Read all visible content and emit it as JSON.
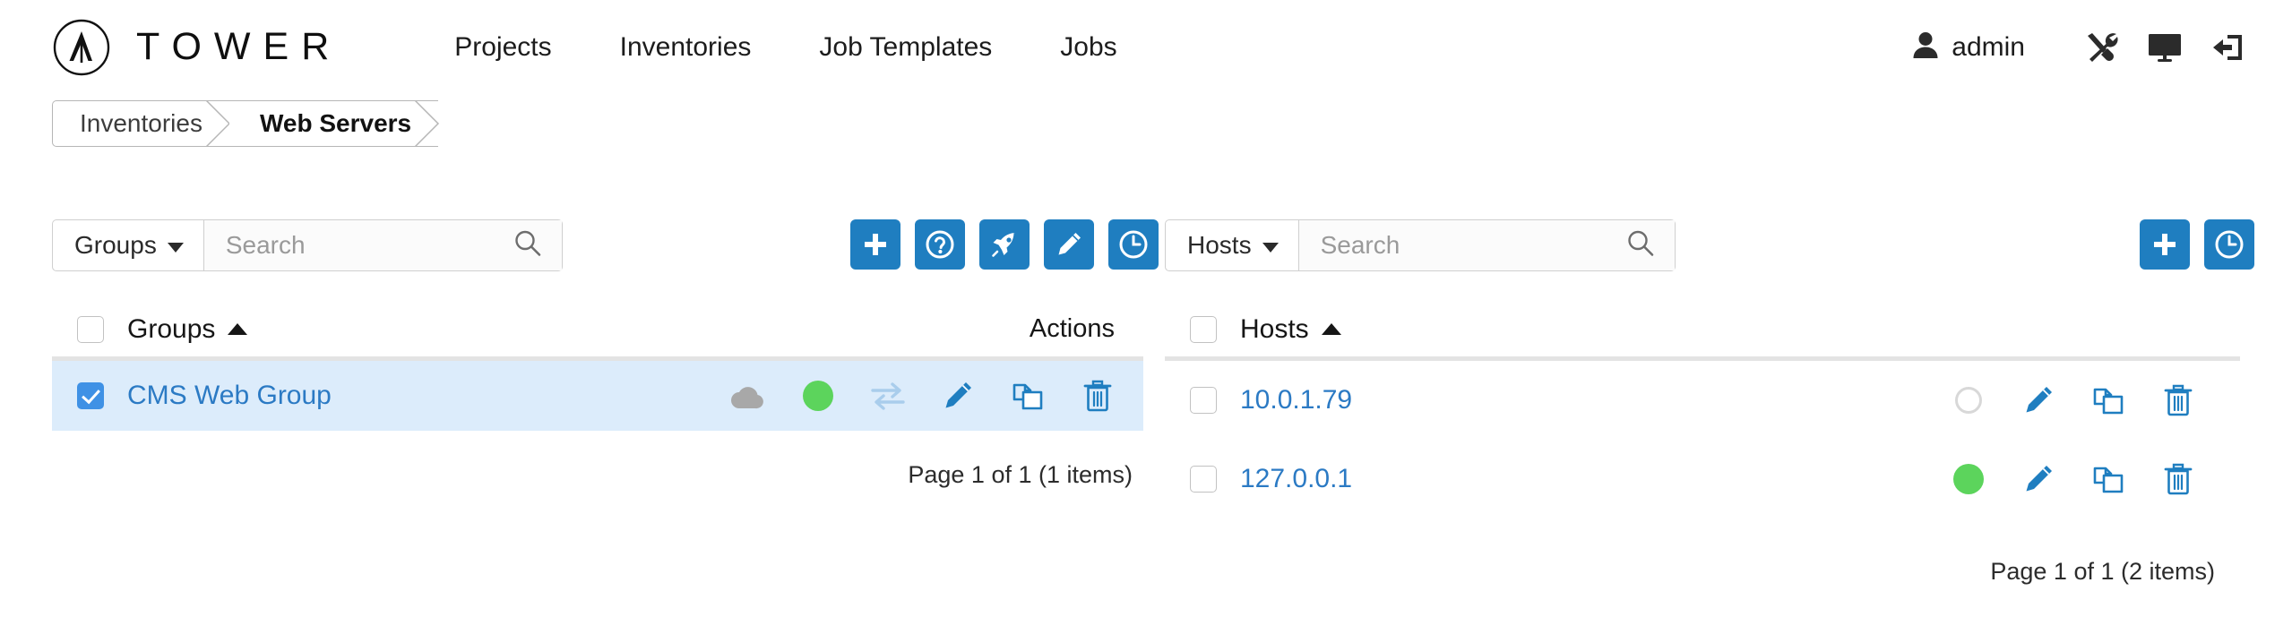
{
  "brand": {
    "name": "TOWER",
    "logo_icon": "ansible-tower-logo-icon"
  },
  "nav": {
    "items": [
      {
        "label": "Projects",
        "name": "projects"
      },
      {
        "label": "Inventories",
        "name": "inventories"
      },
      {
        "label": "Job Templates",
        "name": "job-templates"
      },
      {
        "label": "Jobs",
        "name": "jobs"
      }
    ]
  },
  "account": {
    "username": "admin",
    "user_icon": "user-icon",
    "settings_icon": "wrench-screwdriver-icon",
    "view_icon": "monitor-icon",
    "logout_icon": "logout-arrow-icon"
  },
  "breadcrumb": {
    "items": [
      {
        "label": "Inventories",
        "active": false
      },
      {
        "label": "Web Servers",
        "active": true
      }
    ]
  },
  "groups_panel": {
    "filter": {
      "label": "Groups",
      "placeholder": "Search",
      "value": "",
      "search_icon": "search-icon"
    },
    "actions": [
      {
        "name": "add-group-button",
        "icon": "plus-icon"
      },
      {
        "name": "help-button",
        "icon": "question-circle-icon"
      },
      {
        "name": "launch-button",
        "icon": "rocket-icon"
      },
      {
        "name": "edit-button",
        "icon": "pencil-icon"
      },
      {
        "name": "schedule-button",
        "icon": "clock-icon"
      }
    ],
    "columns": {
      "name": "Groups",
      "actions": "Actions",
      "sort": "asc"
    },
    "rows": [
      {
        "name": "CMS Web Group",
        "selected": true,
        "source_icon": "cloud-icon",
        "status": "green",
        "row_actions": [
          "exchange-icon",
          "pencil-icon",
          "copy-icon",
          "trash-icon"
        ]
      }
    ],
    "pagination": "Page 1 of 1 (1 items)"
  },
  "hosts_panel": {
    "filter": {
      "label": "Hosts",
      "placeholder": "Search",
      "value": "",
      "search_icon": "search-icon"
    },
    "actions": [
      {
        "name": "add-host-button",
        "icon": "plus-icon"
      },
      {
        "name": "schedule-button",
        "icon": "clock-icon"
      }
    ],
    "columns": {
      "name": "Hosts",
      "sort": "asc"
    },
    "rows": [
      {
        "name": "10.0.1.79",
        "selected": false,
        "status": "hollow",
        "row_actions": [
          "pencil-icon",
          "copy-icon",
          "trash-icon"
        ]
      },
      {
        "name": "127.0.0.1",
        "selected": false,
        "status": "green",
        "row_actions": [
          "pencil-icon",
          "copy-icon",
          "trash-icon"
        ]
      }
    ],
    "pagination": "Page 1 of 1 (2 items)"
  },
  "colors": {
    "accent_blue": "#1f7ec0",
    "link_blue": "#2b7ac4",
    "selected_row": "#dcecfb",
    "status_green": "#5cd45c",
    "status_idle": "#d8d8d8",
    "cloud_gray": "#a8a8a8",
    "exchange_blue": "#a9cdec"
  }
}
